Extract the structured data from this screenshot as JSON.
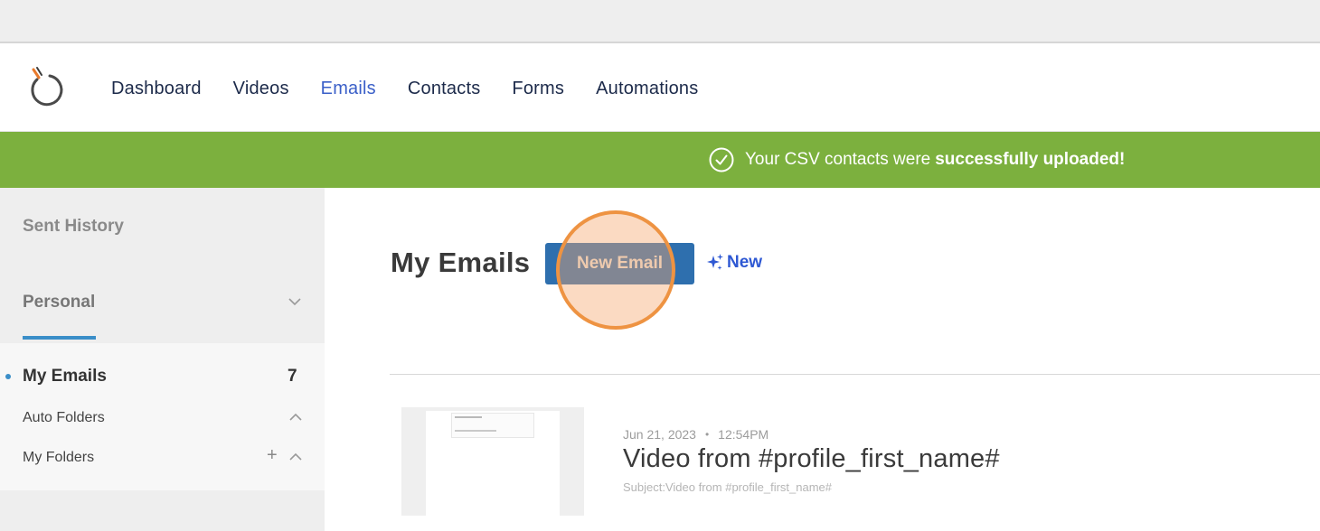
{
  "nav": {
    "items": [
      {
        "label": "Dashboard",
        "active": false
      },
      {
        "label": "Videos",
        "active": false
      },
      {
        "label": "Emails",
        "active": true
      },
      {
        "label": "Contacts",
        "active": false
      },
      {
        "label": "Forms",
        "active": false
      },
      {
        "label": "Automations",
        "active": false
      }
    ]
  },
  "banner": {
    "text": "Your CSV contacts were",
    "strong": "successfully uploaded!",
    "icon": "check-circle-icon",
    "color": "#7cb03e"
  },
  "sidebar": {
    "sent_history": "Sent History",
    "personal": "Personal",
    "my_emails": "My Emails",
    "my_emails_count": "7",
    "auto_folders": "Auto Folders",
    "my_folders": "My Folders",
    "add_symbol": "+"
  },
  "main": {
    "title": "My Emails",
    "new_email_button": "New Email",
    "new_link": "New",
    "accent": "#2e6fae"
  },
  "emails": [
    {
      "date": "Jun 21, 2023",
      "separator": "•",
      "time": "12:54PM",
      "title": "Video from #profile_first_name#",
      "subject": "Subject:Video from #profile_first_name#"
    }
  ]
}
